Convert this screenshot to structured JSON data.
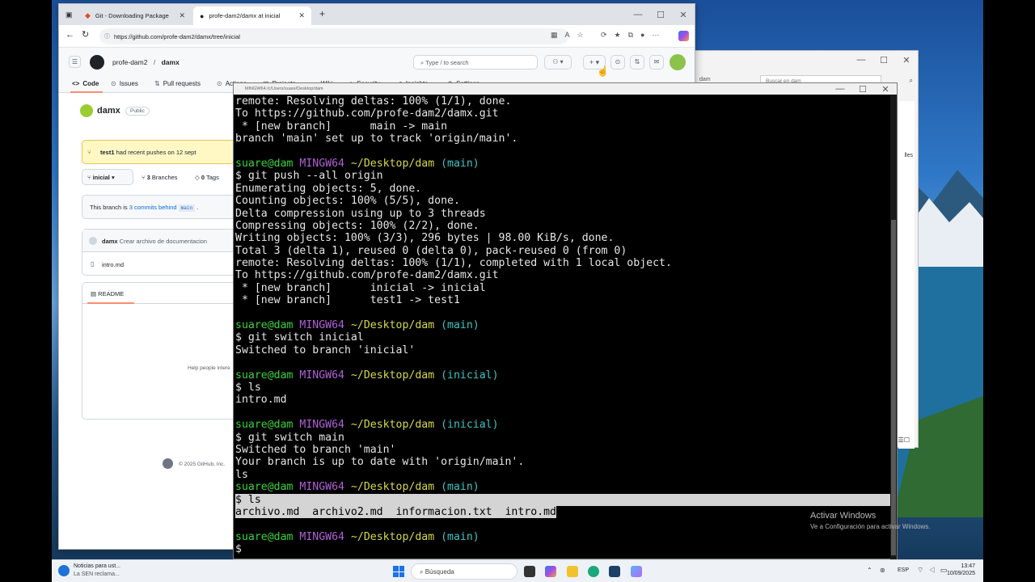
{
  "browser": {
    "tabs": [
      {
        "label": "Git - Downloading Package"
      },
      {
        "label": "profe-dam2/damx at inicial"
      }
    ],
    "url": "https://github.com/profe-dam2/damx/tree/inicial",
    "github": {
      "owner": "profe-dam2",
      "repo": "damx",
      "search_placeholder": "Type / to search",
      "nav": [
        "Code",
        "Issues",
        "Pull requests",
        "Actions",
        "Projects",
        "Wiki",
        "Security",
        "Insights",
        "Settings"
      ],
      "repo_title": "damx",
      "visibility": "Public",
      "push_banner": {
        "branch": "test1",
        "text": "had recent pushes on 12 sept"
      },
      "branch": "inicial",
      "branches_count": "3",
      "branches_label": "Branches",
      "tags_count": "0",
      "tags_label": "Tags",
      "behind_text_prefix": "This branch is",
      "behind_link": "3 commits behind",
      "behind_branch": "main",
      "commit_author": "damx",
      "commit_message": "Crear archivo de documentacion",
      "file": "intro.md",
      "readme_tab": "README",
      "help_text": "Help people intere",
      "footer": "© 2025 GitHub, Inc."
    }
  },
  "terminal": {
    "title": "MINGW64:/c/Users/suare/Desktop/dam",
    "lines": [
      [
        {
          "t": "remote: Resolving deltas: 100% (1/1), done."
        }
      ],
      [
        {
          "t": "To https://github.com/profe-dam2/damx.git"
        }
      ],
      [
        {
          "t": " * [new branch]      main -> main"
        }
      ],
      [
        {
          "t": "branch 'main' set up to track 'origin/main'."
        }
      ],
      [
        {
          "t": ""
        }
      ],
      [
        {
          "t": "suare@dam ",
          "c": "c-green"
        },
        {
          "t": "MINGW64 ",
          "c": "c-purple"
        },
        {
          "t": "~/Desktop/dam ",
          "c": "c-yellow"
        },
        {
          "t": "(main)",
          "c": "c-cyan"
        }
      ],
      [
        {
          "t": "$ git push --all origin"
        }
      ],
      [
        {
          "t": "Enumerating objects: 5, done."
        }
      ],
      [
        {
          "t": "Counting objects: 100% (5/5), done."
        }
      ],
      [
        {
          "t": "Delta compression using up to 3 threads"
        }
      ],
      [
        {
          "t": "Compressing objects: 100% (2/2), done."
        }
      ],
      [
        {
          "t": "Writing objects: 100% (3/3), 296 bytes | 98.00 KiB/s, done."
        }
      ],
      [
        {
          "t": "Total 3 (delta 1), reused 0 (delta 0), pack-reused 0 (from 0)"
        }
      ],
      [
        {
          "t": "remote: Resolving deltas: 100% (1/1), completed with 1 local object."
        }
      ],
      [
        {
          "t": "To https://github.com/profe-dam2/damx.git"
        }
      ],
      [
        {
          "t": " * [new branch]      inicial -> inicial"
        }
      ],
      [
        {
          "t": " * [new branch]      test1 -> test1"
        }
      ],
      [
        {
          "t": ""
        }
      ],
      [
        {
          "t": "suare@dam ",
          "c": "c-green"
        },
        {
          "t": "MINGW64 ",
          "c": "c-purple"
        },
        {
          "t": "~/Desktop/dam ",
          "c": "c-yellow"
        },
        {
          "t": "(main)",
          "c": "c-cyan"
        }
      ],
      [
        {
          "t": "$ git switch inicial"
        }
      ],
      [
        {
          "t": "Switched to branch 'inicial'"
        }
      ],
      [
        {
          "t": ""
        }
      ],
      [
        {
          "t": "suare@dam ",
          "c": "c-green"
        },
        {
          "t": "MINGW64 ",
          "c": "c-purple"
        },
        {
          "t": "~/Desktop/dam ",
          "c": "c-yellow"
        },
        {
          "t": "(inicial)",
          "c": "c-cyan"
        }
      ],
      [
        {
          "t": "$ ls"
        }
      ],
      [
        {
          "t": "intro.md"
        }
      ],
      [
        {
          "t": ""
        }
      ],
      [
        {
          "t": "suare@dam ",
          "c": "c-green"
        },
        {
          "t": "MINGW64 ",
          "c": "c-purple"
        },
        {
          "t": "~/Desktop/dam ",
          "c": "c-yellow"
        },
        {
          "t": "(inicial)",
          "c": "c-cyan"
        }
      ],
      [
        {
          "t": "$ git switch main"
        }
      ],
      [
        {
          "t": "Switched to branch 'main'"
        }
      ],
      [
        {
          "t": "Your branch is up to date with 'origin/main'."
        }
      ],
      [
        {
          "t": "ls"
        }
      ],
      [
        {
          "t": "suare@dam ",
          "c": "c-green"
        },
        {
          "t": "MINGW64 ",
          "c": "c-purple"
        },
        {
          "t": "~/Desktop/dam ",
          "c": "c-yellow"
        },
        {
          "t": "(main)",
          "c": "c-cyan"
        }
      ],
      [
        {
          "t": "$ ls",
          "c": "sel",
          "full": true
        }
      ],
      [
        {
          "t": "archivo.md  archivo2.md  informacion.txt  intro.md",
          "c": "sel"
        }
      ],
      [
        {
          "t": ""
        }
      ],
      [
        {
          "t": "suare@dam ",
          "c": "c-green"
        },
        {
          "t": "MINGW64 ",
          "c": "c-purple"
        },
        {
          "t": "~/Desktop/dam ",
          "c": "c-yellow"
        },
        {
          "t": "(main)",
          "c": "c-cyan"
        }
      ],
      [
        {
          "t": "$ "
        }
      ]
    ]
  },
  "background_window": {
    "search_placeholder": "Buscar en dam",
    "partial_label": "dam",
    "side_text": "lles"
  },
  "watermark": {
    "title": "Activar Windows",
    "subtitle": "Ve a Configuración para activar Windows."
  },
  "taskbar": {
    "news_title": "Noticias para ust...",
    "news_sub": "La SEN reclama...",
    "search": "Búsqueda",
    "lang": "ESP",
    "time": "13:47",
    "date": "10/09/2025"
  }
}
